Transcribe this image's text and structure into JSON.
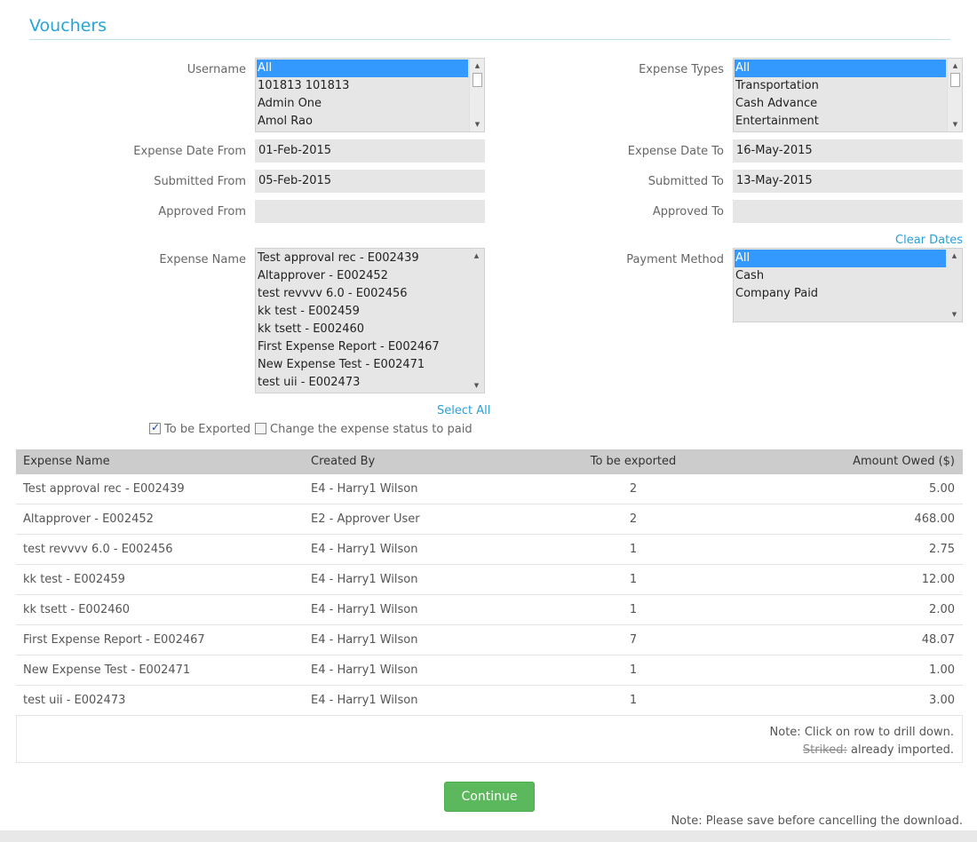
{
  "page": {
    "title": "Vouchers"
  },
  "filters": {
    "username": {
      "label": "Username",
      "options": [
        "All",
        "101813 101813",
        "Admin One",
        "Amol Rao"
      ],
      "selected_index": 0
    },
    "expense_types": {
      "label": "Expense Types",
      "options": [
        "All",
        "Transportation",
        "Cash Advance",
        "Entertainment"
      ],
      "selected_index": 0
    },
    "expense_date_from": {
      "label": "Expense Date From",
      "value": "01-Feb-2015"
    },
    "expense_date_to": {
      "label": "Expense Date To",
      "value": "16-May-2015"
    },
    "submitted_from": {
      "label": "Submitted From",
      "value": "05-Feb-2015"
    },
    "submitted_to": {
      "label": "Submitted To",
      "value": "13-May-2015"
    },
    "approved_from": {
      "label": "Approved From",
      "value": ""
    },
    "approved_to": {
      "label": "Approved To",
      "value": ""
    },
    "clear_dates": "Clear Dates",
    "expense_name": {
      "label": "Expense Name",
      "options": [
        "Test approval rec - E002439",
        "Altapprover - E002452",
        "test revvvv 6.0 - E002456",
        "kk test - E002459",
        "kk tsett - E002460",
        "First Expense Report - E002467",
        "New Expense Test - E002471",
        "test uii - E002473"
      ]
    },
    "select_all": "Select All",
    "payment_method": {
      "label": "Payment Method",
      "options": [
        "All",
        "Cash",
        "Company Paid"
      ],
      "selected_index": 0
    },
    "to_be_exported": {
      "label": "To be Exported",
      "checked": true
    },
    "change_status": {
      "label": "Change the expense status to paid",
      "checked": false
    }
  },
  "table": {
    "headers": [
      "Expense Name",
      "Created By",
      "To be exported",
      "Amount Owed ($)"
    ],
    "rows": [
      [
        "Test approval rec - E002439",
        "E4 - Harry1 Wilson",
        "2",
        "5.00"
      ],
      [
        "Altapprover - E002452",
        "E2 - Approver User",
        "2",
        "468.00"
      ],
      [
        "test revvvv 6.0 - E002456",
        "E4 - Harry1 Wilson",
        "1",
        "2.75"
      ],
      [
        "kk test - E002459",
        "E4 - Harry1 Wilson",
        "1",
        "12.00"
      ],
      [
        "kk tsett - E002460",
        "E4 - Harry1 Wilson",
        "1",
        "2.00"
      ],
      [
        "First Expense Report - E002467",
        "E4 - Harry1 Wilson",
        "7",
        "48.07"
      ],
      [
        "New Expense Test - E002471",
        "E4 - Harry1 Wilson",
        "1",
        "1.00"
      ],
      [
        "test uii - E002473",
        "E4 - Harry1 Wilson",
        "1",
        "3.00"
      ]
    ],
    "note_drill": "Note: Click on row to drill down.",
    "note_striked_word": "Striked:",
    "note_striked_rest": " already imported."
  },
  "actions": {
    "continue_label": "Continue"
  },
  "footer": {
    "note": "Note: Please save before cancelling the download."
  },
  "colors": {
    "accent": "#2aa4d5",
    "selection": "#3399ff",
    "button": "#5cb85c"
  }
}
